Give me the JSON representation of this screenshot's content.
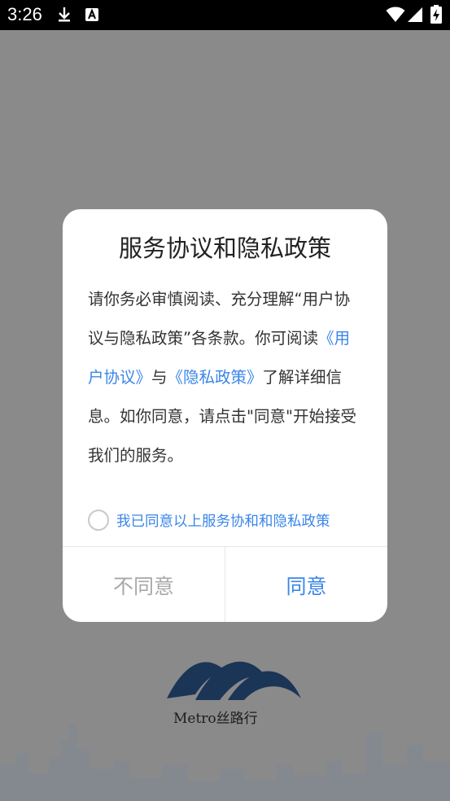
{
  "status_bar": {
    "time": "3:26",
    "icons": [
      "download-icon",
      "a-notification-icon",
      "wifi-icon",
      "cellular-signal-icon",
      "battery-charging-icon"
    ]
  },
  "dialog": {
    "title": "服务协议和隐私政策",
    "body": {
      "text_1": "请你务必审慎阅读、充分理解“用户协议与隐私政策”各条款。你可阅读",
      "link_user_agreement": "《用户协议》",
      "text_2": "与",
      "link_privacy_policy": "《隐私政策》",
      "text_3": "了解详细信息。如你同意，请点击\"同意\"开始接受我们的服务。"
    },
    "consent_label": "我已同意以上服务协和和隐私政策",
    "consent_checked": false,
    "disagree_label": "不同意",
    "agree_label": "同意"
  },
  "background": {
    "logo_text": "Metro丝路行"
  },
  "colors": {
    "accent": "#3a86e8",
    "overlay": "#8a8a8a",
    "disabled_text": "#a8a8a8"
  }
}
